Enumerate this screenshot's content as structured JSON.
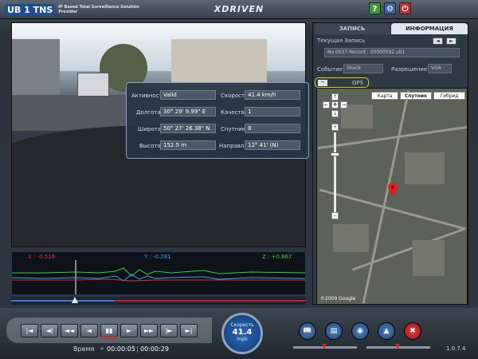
{
  "app": {
    "logo_text": "UB 1 TNS",
    "tagline": "IP Based Total Surveillance Solution Provider",
    "brand": "XDRIVEN",
    "help_label": "?",
    "settings_label": "⚙",
    "power_label": "⏻",
    "version": "1.0.7.4"
  },
  "gps_overlay": {
    "rows": [
      {
        "label": "Активность",
        "value": "Valid",
        "label2": "Скорость",
        "value2": "41.4 km/h"
      },
      {
        "label": "Долгота",
        "value": "30° 29' 9.99\" E",
        "label2": "Качество",
        "value2": "1"
      },
      {
        "label": "Широта",
        "value": "50° 27' 26.38\" N",
        "label2": "Спутники",
        "value2": "8"
      },
      {
        "label": "Высота",
        "value": "152.5 m",
        "label2": "Направл.",
        "value2": "12° 41' (N)"
      }
    ]
  },
  "graph": {
    "x_label": "X : -0.516",
    "y_label": "Y : -0.281",
    "z_label": "Z : +0.867"
  },
  "panel": {
    "tab_records": "ЗАПИСЬ",
    "tab_info": "ИНФОРМАЦИЯ",
    "current_record_label": "Текущая Запись",
    "record_value": "No.0037 Record : 00000592.ub1",
    "event_label": "Событие",
    "event_value": "Shock",
    "resolution_label": "Разрешение",
    "resolution_value": "VGA",
    "gps_label": "GPS",
    "gps_toggle": "−"
  },
  "map": {
    "tabs": [
      "Карта",
      "Спутник",
      "Гибрид"
    ],
    "active_tab": "Спутник",
    "pan_up": "↑",
    "pan_down": "↓",
    "pan_left": "←",
    "pan_right": "→",
    "pan_center": "✥",
    "zoom_in": "+",
    "zoom_out": "−",
    "copyright": "©2009 Google"
  },
  "player": {
    "time_label": "Время",
    "time_current": "00:00:05",
    "time_total": "00:00:29",
    "speed_label": "Скорость",
    "speed_value": "41.4",
    "speed_unit": "mph",
    "buttons": {
      "first": "|◄",
      "prev_frame": "◄|",
      "rewind": "◄◄",
      "play_back": "◄",
      "pause": "▮▮",
      "play": "►",
      "fast_forward": "►►",
      "next_frame": "|►",
      "last": "►|"
    }
  },
  "colors": {
    "accent": "#2b69b8",
    "x_axis": "#e03030",
    "y_axis": "#3aa0ff",
    "z_axis": "#30d040",
    "gps_highlight": "#e8d000"
  }
}
